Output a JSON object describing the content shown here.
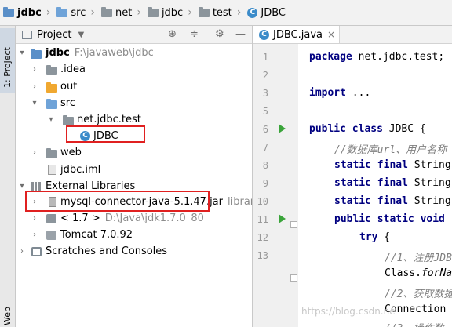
{
  "breadcrumb": [
    "jdbc",
    "src",
    "net",
    "jdbc",
    "test",
    "JDBC"
  ],
  "toolstrip": {
    "project_tab": "1: Project",
    "web_tab": "Web"
  },
  "project_panel": {
    "title": "Project",
    "tree": {
      "root": {
        "name": "jdbc",
        "path": "F:\\javaweb\\jdbc"
      },
      "idea": ".idea",
      "out": "out",
      "src": "src",
      "package": "net.jdbc.test",
      "jdbc_class": "JDBC",
      "web": "web",
      "iml": "jdbc.iml",
      "external_libraries": "External Libraries",
      "mysql_jar": "mysql-connector-java-5.1.47.jar",
      "mysql_jar_suffix": "library ro",
      "jdk": "< 1.7 >",
      "jdk_path": "D:\\Java\\jdk1.7.0_80",
      "tomcat": "Tomcat 7.0.92",
      "scratches": "Scratches and Consoles"
    }
  },
  "editor": {
    "tab_label": "JDBC.java",
    "line_numbers": [
      "1",
      "2",
      "3",
      "5",
      "6",
      "7",
      "8",
      "9",
      "10",
      "11",
      "12",
      "13"
    ],
    "lines": {
      "l1_kw": "package",
      "l1_rest": " net.jdbc.test;",
      "l3_kw": "import",
      "l3_rest": " ...",
      "l6_kw": "public class",
      "l6_rest": " JDBC {",
      "l7": "//数据库url、用户名称",
      "l8_kw": "static final",
      "l8_rest": " String",
      "l9_kw": "static final",
      "l9_rest": " String",
      "l10_kw": "static final",
      "l10_rest": " String",
      "l11_kw": "public static void",
      "l11_rest": "",
      "l12_kw": "try",
      "l12_rest": " {",
      "l13": "//1、注册JDBC",
      "l14_a": "Class.",
      "l14_b": "forNa",
      "l15": "//2、获取数据",
      "l16": "Connection",
      "l17": "//3、操作数"
    }
  },
  "watermark": "https://blog.csdn.ne",
  "colors": {
    "highlight_red": "#e02020",
    "keyword": "#000080",
    "comment": "#808080",
    "run_green": "#3aa43a"
  }
}
